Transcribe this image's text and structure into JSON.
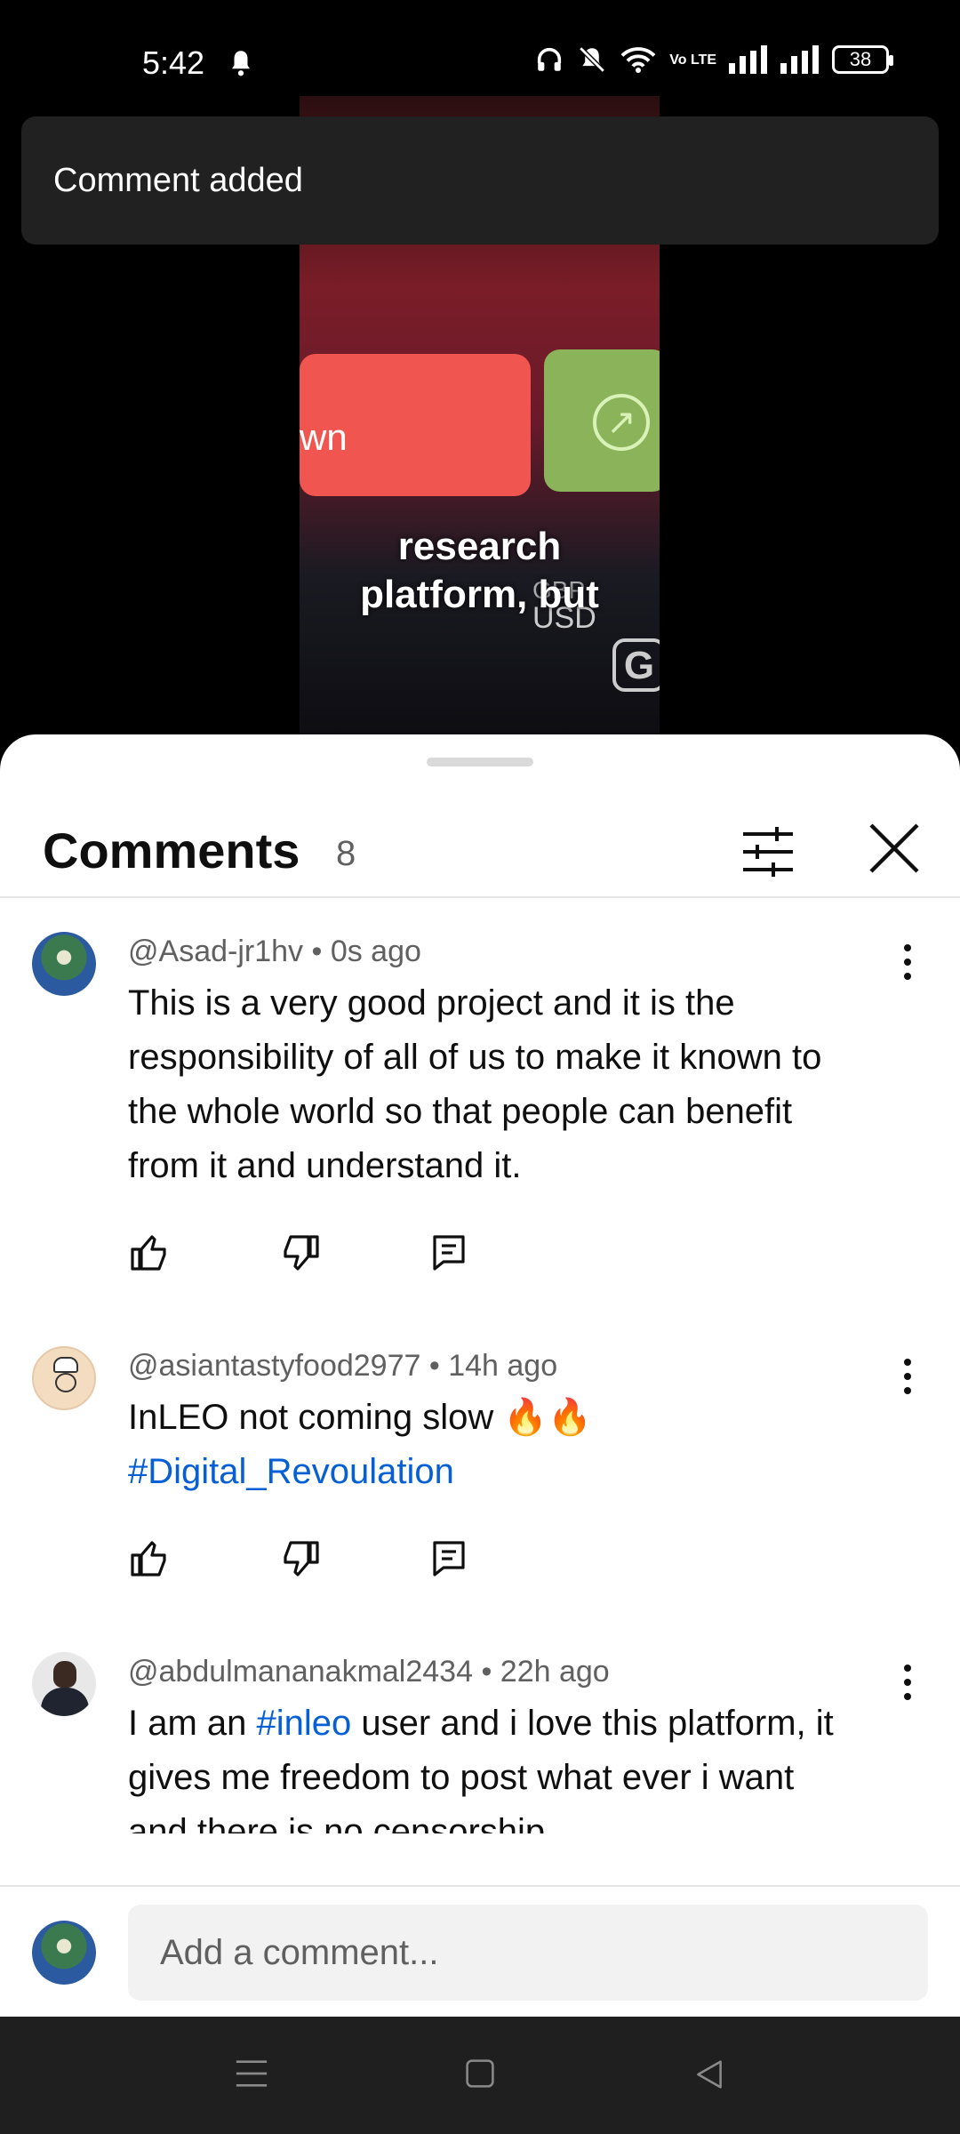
{
  "status_bar": {
    "time": "5:42",
    "battery": "38",
    "network_label": "Vo LTE"
  },
  "video": {
    "caption_line1": "research",
    "caption_line2": "platform, but",
    "overlay_button_text": "wn",
    "currency_text": "USD",
    "currency_small": "GBP",
    "logo_letter": "G"
  },
  "toast": {
    "message": "Comment added"
  },
  "comments_panel": {
    "title": "Comments",
    "count": "8"
  },
  "comments": [
    {
      "author": "@Asad-jr1hv",
      "time": "0s ago",
      "text": "This is a very good project and it is the responsibility of all of us to make it known to the whole world so that people can benefit from it and understand it."
    },
    {
      "author": "@asiantastyfood2977",
      "time": "14h ago",
      "text": "InLEO not coming slow 🔥🔥",
      "hashtag": "#Digital_Revoulation"
    },
    {
      "author": "@abdulmananakmal2434",
      "time": "22h ago",
      "text_before": "I am an ",
      "hashtag": "#inleo",
      "text_after": " user and i love this platform, it gives me freedom to post what ever i want and there is no censorship."
    }
  ],
  "separator": " • ",
  "add_comment": {
    "placeholder": "Add a comment..."
  },
  "colors": {
    "link": "#065fd4",
    "toast_bg": "#212121",
    "meta_text": "#606060"
  }
}
